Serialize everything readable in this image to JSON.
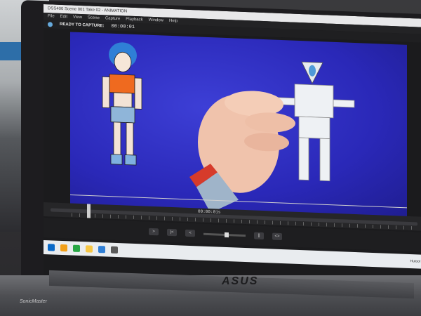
{
  "window": {
    "title": "DSS400 Scene 001 Take 02 - ANIMATION",
    "menus": [
      "File",
      "Edit",
      "View",
      "Scene",
      "Capture",
      "Playback",
      "Window",
      "Help"
    ]
  },
  "status": {
    "label": "READY TO CAPTURE:",
    "timecode": "00:00:01"
  },
  "timeline": {
    "time": "00:00:01s"
  },
  "controls": [
    ">",
    "|<",
    "<",
    "||",
    "<>"
  ],
  "taskbar": {
    "right_text": [
      "Hutool"
    ]
  },
  "device": {
    "brand": "ASUS",
    "sonicmaster": "SonicMaster"
  },
  "colors": {
    "viewport_blue": "#2a28b8",
    "ui_dark": "#1e1e20",
    "accent": "#6aaddd"
  }
}
